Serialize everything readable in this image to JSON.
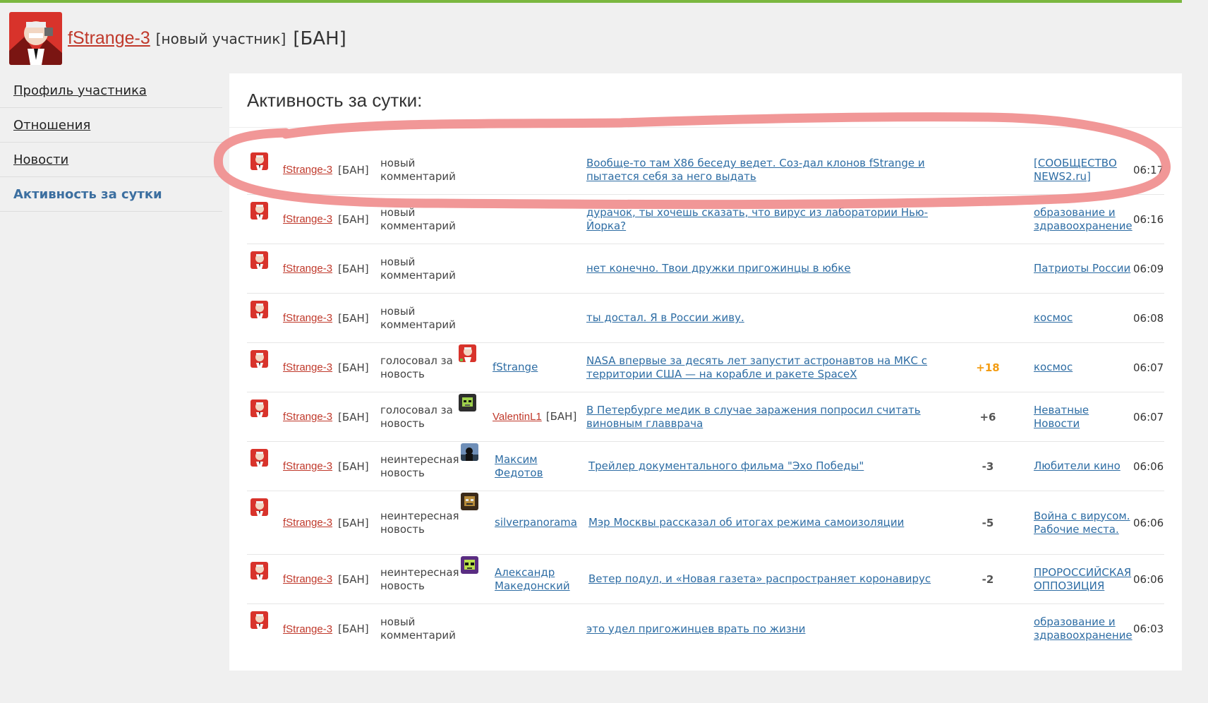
{
  "header": {
    "username": "fStrange-3",
    "role": "[новый участник]",
    "ban": "[БАН]"
  },
  "sidebar": {
    "items": [
      {
        "label": "Профиль участника",
        "active": false
      },
      {
        "label": "Отношения",
        "active": false
      },
      {
        "label": "Новости",
        "active": false
      },
      {
        "label": "Активность за сутки",
        "active": true
      }
    ]
  },
  "main": {
    "title": "Активность за сутки:",
    "rows": [
      {
        "user": "fStrange-3",
        "ban": "[БАН]",
        "action": "новый комментарий",
        "target": "",
        "target_ban": "",
        "text": "Вообще-то там X86 беседу ведет. Соз-дал клонов fStrange и пытается себя за него выдать",
        "score": "",
        "category": "[СООБЩЕСТВО NEWS2.ru]",
        "time": "06:17"
      },
      {
        "user": "fStrange-3",
        "ban": "[БАН]",
        "action": "новый комментарий",
        "target": "",
        "target_ban": "",
        "text": "дурачок, ты хочешь сказать, что вирус из лаборатории Нью-Йорка?",
        "score": "",
        "category": "образование и здравоохранение",
        "time": "06:16"
      },
      {
        "user": "fStrange-3",
        "ban": "[БАН]",
        "action": "новый комментарий",
        "target": "",
        "target_ban": "",
        "text": "нет конечно. Твои дружки пригожинцы в юбке",
        "score": "",
        "category": "Патриоты России",
        "time": "06:09"
      },
      {
        "user": "fStrange-3",
        "ban": "[БАН]",
        "action": "новый комментарий",
        "target": "",
        "target_ban": "",
        "text": "ты достал. Я в России живу.",
        "score": "",
        "category": "космос",
        "time": "06:08"
      },
      {
        "user": "fStrange-3",
        "ban": "[БАН]",
        "action": "голосовал за новость",
        "target": "fStrange",
        "target_ban": "",
        "text": "NASA впервые за десять лет запустит астронавтов на МКС с территории США — на корабле и ракете SpaceX",
        "score": "+18",
        "category": "космос",
        "time": "06:07"
      },
      {
        "user": "fStrange-3",
        "ban": "[БАН]",
        "action": "голосовал за новость",
        "target": "ValentinL1",
        "target_ban": "[БАН]",
        "text": "В Петербурге медик в случае заражения попросил считать виновным главврача",
        "score": "+6",
        "category": "Неватные Новости",
        "time": "06:07"
      },
      {
        "user": "fStrange-3",
        "ban": "[БАН]",
        "action": "неинтересная новость",
        "target": "Максим Федотов",
        "target_ban": "",
        "text": "Трейлер документального фильма \"Эхо Победы\"",
        "score": "-3",
        "category": "Любители кино",
        "time": "06:06"
      },
      {
        "user": "fStrange-3",
        "ban": "[БАН]",
        "action": "неинтересная новость",
        "target": "silverpanorama",
        "target_ban": "",
        "text": "Мэр Москвы рассказал об итогах режима самоизоляции",
        "score": "-5",
        "category": "Война с вирусом. Рабочие места.",
        "time": "06:06"
      },
      {
        "user": "fStrange-3",
        "ban": "[БАН]",
        "action": "неинтересная новость",
        "target": "Александр Македонский",
        "target_ban": "",
        "text": "Ветер подул, и «Новая газета» распространяет коронавирус",
        "score": "-2",
        "category": "ПРОРОССИЙСКАЯ ОППОЗИЦИЯ",
        "time": "06:06"
      },
      {
        "user": "fStrange-3",
        "ban": "[БАН]",
        "action": "новый комментарий",
        "target": "",
        "target_ban": "",
        "text": "это удел пригожинцев врать по жизни",
        "score": "",
        "category": "образование и здравоохранение",
        "time": "06:03"
      }
    ]
  },
  "colors": {
    "top_bar": "#7bb73f",
    "username": "#c0392b",
    "link": "#2e6da4",
    "positive_score": "#f39c12",
    "highlight": "#f08c8c"
  }
}
